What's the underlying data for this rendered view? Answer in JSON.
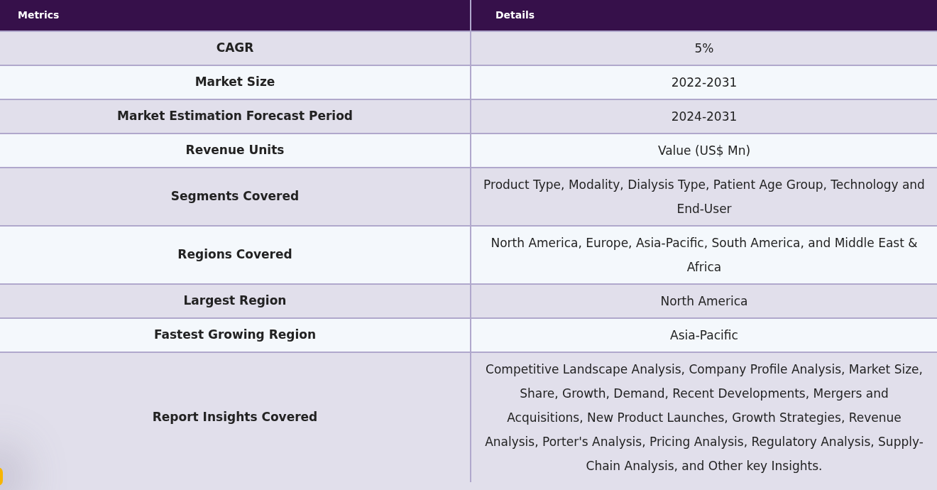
{
  "table": {
    "columns": [
      "Metrics",
      "Details"
    ],
    "rows": [
      {
        "metric": "CAGR",
        "details": "5%"
      },
      {
        "metric": "Market Size",
        "details": "2022-2031"
      },
      {
        "metric": "Market Estimation Forecast Period",
        "details": "2024-2031"
      },
      {
        "metric": "Revenue Units",
        "details": "Value (US$ Mn)"
      },
      {
        "metric": "Segments Covered",
        "details": "Product Type, Modality, Dialysis Type, Patient Age Group, Technology and End-User"
      },
      {
        "metric": "Regions Covered",
        "details": "North America, Europe, Asia-Pacific, South America, and Middle East & Africa"
      },
      {
        "metric": "Largest Region",
        "details": "North America"
      },
      {
        "metric": "Fastest Growing Region",
        "details": "Asia-Pacific"
      },
      {
        "metric": "Report Insights Covered",
        "details": "Competitive Landscape Analysis, Company Profile Analysis, Market Size, Share, Growth, Demand, Recent Developments, Mergers and Acquisitions, New Product Launches, Growth Strategies, Revenue Analysis, Porter's Analysis, Pricing Analysis, Regulatory Analysis, Supply-Chain Analysis, and Other key Insights."
      }
    ]
  }
}
